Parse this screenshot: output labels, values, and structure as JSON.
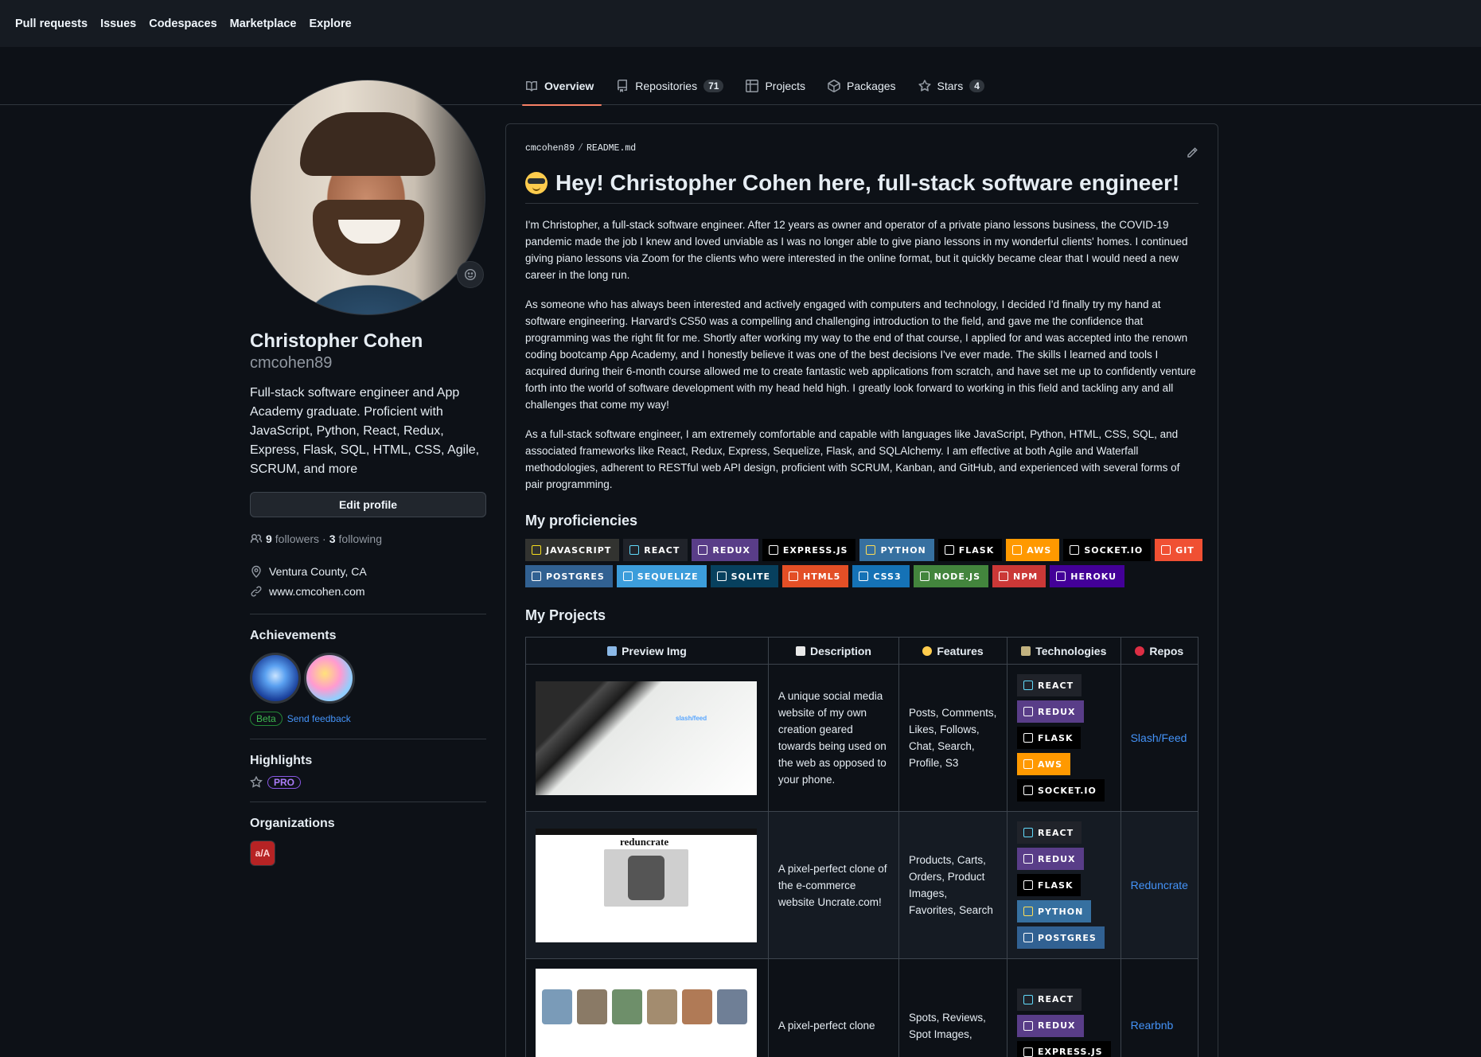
{
  "topnav": [
    "Pull requests",
    "Issues",
    "Codespaces",
    "Marketplace",
    "Explore"
  ],
  "tabs": [
    {
      "label": "Overview",
      "icon": "book-icon",
      "count": null,
      "active": true
    },
    {
      "label": "Repositories",
      "icon": "repo-icon",
      "count": "71",
      "active": false
    },
    {
      "label": "Projects",
      "icon": "table-icon",
      "count": null,
      "active": false
    },
    {
      "label": "Packages",
      "icon": "package-icon",
      "count": null,
      "active": false
    },
    {
      "label": "Stars",
      "icon": "star-icon",
      "count": "4",
      "active": false
    }
  ],
  "profile": {
    "name": "Christopher Cohen",
    "login": "cmcohen89",
    "bio": "Full-stack software engineer and App Academy graduate. Proficient with JavaScript, Python, React, Redux, Express, Flask, SQL, HTML, CSS, Agile, SCRUM, and more",
    "edit_label": "Edit profile",
    "followers_count": "9",
    "followers_label": "followers",
    "sep": "·",
    "following_count": "3",
    "following_label": "following",
    "location": "Ventura County, CA",
    "website": "www.cmcohen.com"
  },
  "achievements": {
    "title": "Achievements",
    "beta": "Beta",
    "feedback": "Send feedback"
  },
  "highlights": {
    "title": "Highlights",
    "pro": "PRO"
  },
  "organizations": {
    "title": "Organizations",
    "org_text": "a/A"
  },
  "readme": {
    "owner": "cmcohen89",
    "slash": "/",
    "file": "README.md",
    "heading": "Hey! Christopher Cohen here, full-stack software engineer!",
    "paragraphs": [
      "I'm Christopher, a full-stack software engineer. After 12 years as owner and operator of a private piano lessons business, the COVID-19 pandemic made the job I knew and loved unviable as I was no longer able to give piano lessons in my wonderful clients' homes. I continued giving piano lessons via Zoom for the clients who were interested in the online format, but it quickly became clear that I would need a new career in the long run.",
      "As someone who has always been interested and actively engaged with computers and technology, I decided I'd finally try my hand at software engineering. Harvard's CS50 was a compelling and challenging introduction to the field, and gave me the confidence that programming was the right fit for me. Shortly after working my way to the end of that course, I applied for and was accepted into the renown coding bootcamp App Academy, and I honestly believe it was one of the best decisions I've ever made. The skills I learned and tools I acquired during their 6-month course allowed me to create fantastic web applications from scratch, and have set me up to confidently venture forth into the world of software development with my head held high. I greatly look forward to working in this field and tackling any and all challenges that come my way!",
      "As a full-stack software engineer, I am extremely comfortable and capable with languages like JavaScript, Python, HTML, CSS, SQL, and associated frameworks like React, Redux, Express, Sequelize, Flask, and SQLAlchemy. I am effective at both Agile and Waterfall methodologies, adherent to RESTful web API design, proficient with SCRUM, Kanban, and GitHub, and experienced with several forms of pair programming."
    ],
    "proficiencies_title": "My proficiencies",
    "proficiencies": [
      {
        "label": "javascript",
        "color": "#323330",
        "icon_color": "#f7df1e"
      },
      {
        "label": "react",
        "color": "#20232a",
        "icon_color": "#61dafb"
      },
      {
        "label": "redux",
        "color": "#593d88",
        "icon_color": "#ffffff"
      },
      {
        "label": "express.js",
        "color": "#000000",
        "icon_color": "#ffffff"
      },
      {
        "label": "python",
        "color": "#3670a0",
        "icon_color": "#ffdd54"
      },
      {
        "label": "flask",
        "color": "#000000",
        "icon_color": "#ffffff"
      },
      {
        "label": "aws",
        "color": "#ff9900",
        "icon_color": "#ffffff"
      },
      {
        "label": "socket.io",
        "color": "#000000",
        "icon_color": "#ffffff"
      },
      {
        "label": "git",
        "color": "#f05033",
        "icon_color": "#ffffff"
      },
      {
        "label": "postgres",
        "color": "#316192",
        "icon_color": "#ffffff"
      },
      {
        "label": "sequelize",
        "color": "#3c9ddb",
        "icon_color": "#ffffff"
      },
      {
        "label": "sqlite",
        "color": "#07405e",
        "icon_color": "#ffffff"
      },
      {
        "label": "html5",
        "color": "#e34f26",
        "icon_color": "#ffffff"
      },
      {
        "label": "css3",
        "color": "#1572b6",
        "icon_color": "#ffffff"
      },
      {
        "label": "node.js",
        "color": "#43853d",
        "icon_color": "#ffffff"
      },
      {
        "label": "npm",
        "color": "#cb3837",
        "icon_color": "#ffffff"
      },
      {
        "label": "heroku",
        "color": "#430098",
        "icon_color": "#ffffff"
      }
    ],
    "projects_title": "My Projects",
    "table_headers": [
      "Preview Img",
      "Description",
      "Features",
      "Technologies",
      "Repos"
    ],
    "projects": [
      {
        "preview": "slash/feed",
        "description": "A unique social media website of my own creation geared towards being used on the web as opposed to your phone.",
        "features": "Posts, Comments, Likes, Follows, Chat, Search, Profile, S3",
        "tech": [
          "react",
          "redux",
          "flask",
          "aws",
          "socket.io"
        ],
        "repo": "Slash/Feed"
      },
      {
        "preview": "reduncrate",
        "description": "A pixel-perfect clone of the e-commerce website Uncrate.com!",
        "features": "Products, Carts, Orders, Product Images, Favorites, Search",
        "tech": [
          "react",
          "redux",
          "flask",
          "python",
          "postgres"
        ],
        "repo": "Reduncrate"
      },
      {
        "preview": "",
        "description": "A pixel-perfect clone",
        "features": "Spots, Reviews, Spot Images,",
        "tech": [
          "react",
          "redux",
          "express.js"
        ],
        "repo": "Rearbnb"
      }
    ]
  }
}
